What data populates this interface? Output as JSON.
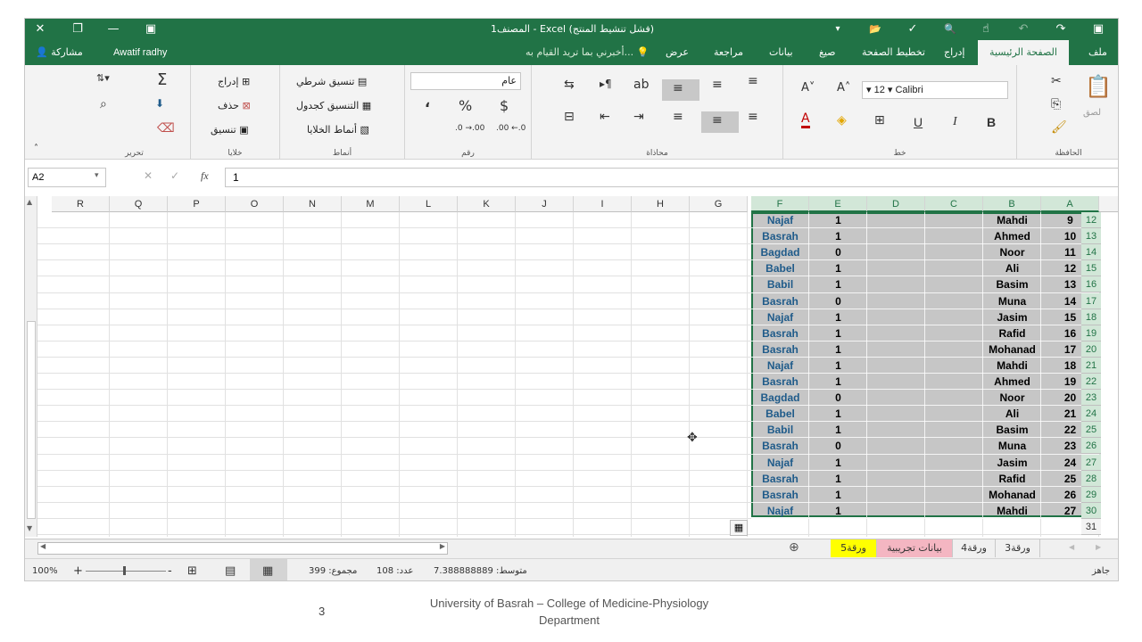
{
  "titlebar": {
    "title": "المصنف1 - Excel (فشل تنشيط المنتج)",
    "close_icon": "✕",
    "restore_icon": "❐",
    "minimize_icon": "—",
    "ribbon_display_icon": "▣",
    "save_icon": "▣",
    "redo_icon": "↷",
    "undo_icon": "↶",
    "touch_icon": "☝",
    "preview_icon": "🔍",
    "spell_icon": "✓",
    "open_icon": "📂",
    "customize_icon": "▾"
  },
  "tabs": {
    "file": "ملف",
    "home": "الصفحة الرئيسية",
    "insert": "إدراج",
    "page_layout": "تخطيط الصفحة",
    "formulas": "صيغ",
    "data": "بيانات",
    "review": "مراجعة",
    "view": "عرض",
    "tell_me": "أخبرني بما تريد القيام به...",
    "user": "Awatif radhy",
    "share": "مشاركة"
  },
  "ribbon": {
    "clipboard_label": "الحافظة",
    "paste": "لصق",
    "font_label": "خط",
    "font_name": "Calibri",
    "font_size": "12",
    "bold": "B",
    "italic": "I",
    "underline": "U",
    "increase_font": "A˄",
    "decrease_font": "A˅",
    "alignment_label": "محاذاة",
    "number_label": "رقم",
    "number_format": "عام",
    "currency": "$",
    "percent": "%",
    "comma": "،",
    "inc_decimal": ".00 ←.0",
    "dec_decimal": ".0 →.00",
    "styles_label": "أنماط",
    "conditional_formatting": "تنسيق شرطي",
    "format_as_table": "التنسيق كجدول",
    "cell_styles": "أنماط الخلايا",
    "cells_label": "خلايا",
    "insert": "إدراج",
    "delete": "حذف",
    "format": "تنسيق",
    "editing_label": "تحرير",
    "sum_icon": "Σ",
    "collapse_icon": "˄"
  },
  "formula_bar": {
    "name_box": "A2",
    "fx": "fx",
    "cancel": "✕",
    "enter": "✓",
    "value": "1"
  },
  "columns": [
    "R",
    "Q",
    "P",
    "O",
    "N",
    "M",
    "L",
    "K",
    "J",
    "I",
    "H",
    "G",
    "F",
    "E",
    "D",
    "C",
    "B",
    "A"
  ],
  "rows": [
    {
      "row": "12",
      "A": "9",
      "B": "Mahdi",
      "E": "1",
      "F": "Najaf"
    },
    {
      "row": "13",
      "A": "10",
      "B": "Ahmed",
      "E": "1",
      "F": "Basrah"
    },
    {
      "row": "14",
      "A": "11",
      "B": "Noor",
      "E": "0",
      "F": "Bagdad"
    },
    {
      "row": "15",
      "A": "12",
      "B": "Ali",
      "E": "1",
      "F": "Babel"
    },
    {
      "row": "16",
      "A": "13",
      "B": "Basim",
      "E": "1",
      "F": "Babil"
    },
    {
      "row": "17",
      "A": "14",
      "B": "Muna",
      "E": "0",
      "F": "Basrah"
    },
    {
      "row": "18",
      "A": "15",
      "B": "Jasim",
      "E": "1",
      "F": "Najaf"
    },
    {
      "row": "19",
      "A": "16",
      "B": "Rafid",
      "E": "1",
      "F": "Basrah"
    },
    {
      "row": "20",
      "A": "17",
      "B": "Mohanad",
      "E": "1",
      "F": "Basrah"
    },
    {
      "row": "21",
      "A": "18",
      "B": "Mahdi",
      "E": "1",
      "F": "Najaf"
    },
    {
      "row": "22",
      "A": "19",
      "B": "Ahmed",
      "E": "1",
      "F": "Basrah"
    },
    {
      "row": "23",
      "A": "20",
      "B": "Noor",
      "E": "0",
      "F": "Bagdad"
    },
    {
      "row": "24",
      "A": "21",
      "B": "Ali",
      "E": "1",
      "F": "Babel"
    },
    {
      "row": "25",
      "A": "22",
      "B": "Basim",
      "E": "1",
      "F": "Babil"
    },
    {
      "row": "26",
      "A": "23",
      "B": "Muna",
      "E": "0",
      "F": "Basrah"
    },
    {
      "row": "27",
      "A": "24",
      "B": "Jasim",
      "E": "1",
      "F": "Najaf"
    },
    {
      "row": "28",
      "A": "25",
      "B": "Rafid",
      "E": "1",
      "F": "Basrah"
    },
    {
      "row": "29",
      "A": "26",
      "B": "Mohanad",
      "E": "1",
      "F": "Basrah"
    },
    {
      "row": "30",
      "A": "27",
      "B": "Mahdi",
      "E": "1",
      "F": "Najaf"
    },
    {
      "row": "31",
      "A": "",
      "B": "",
      "E": "",
      "F": ""
    }
  ],
  "sheets": {
    "sheet5": "ورقة5",
    "trial_data": "بيانات تجريبية",
    "sheet4": "ورقة4",
    "sheet3": "ورقة3",
    "add_sheet": "⊕"
  },
  "status": {
    "ready": "جاهز",
    "average": "متوسط: 7.388888889",
    "count": "عدد: 108",
    "sum": "مجموع: 399",
    "zoom": "100%"
  },
  "footer": {
    "page_number": "3",
    "line1": "University of Basrah – College of Medicine-Physiology",
    "line2": "Department"
  },
  "colors": {
    "accent": "#217346",
    "city_text": "#1f5b8a",
    "selection_fill": "#c6c6c6",
    "tab_yellow": "#ffff00",
    "tab_pink": "#f4b6c2"
  }
}
